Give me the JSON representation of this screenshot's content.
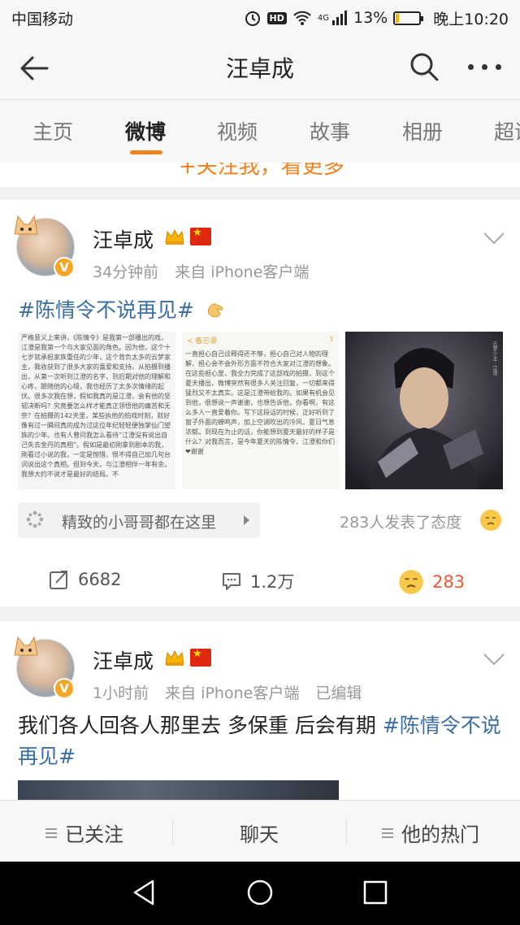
{
  "status_bar": {
    "carrier": "中国移动",
    "hd": "HD",
    "network": "4G",
    "battery": "13%",
    "battery_level": 0.13,
    "time": "晚上10:20"
  },
  "nav": {
    "title": "汪卓成"
  },
  "tabs": [
    {
      "label": "主页",
      "active": false
    },
    {
      "label": "微博",
      "active": true
    },
    {
      "label": "视频",
      "active": false
    },
    {
      "label": "故事",
      "active": false
    },
    {
      "label": "相册",
      "active": false
    },
    {
      "label": "超话",
      "active": false
    }
  ],
  "partial_banner": "+关注我，看更多",
  "posts": [
    {
      "username": "汪卓成",
      "time": "34分钟前",
      "source": "来自 iPhone客户端",
      "text": "#陈情令不说再见#",
      "images": [
        {
          "text": "严格意义上来讲，《陈情令》是我第一部播出的戏，江澄是我第一个与大家见面的角色。因为他，这个十七岁就承担家族重任的少年，这个背负太多的云梦家主，我收获到了很多大家的喜爱和支持。从拍摄到播出，从第一次听到江澄的名字，到后期对他的理解和心疼，跟随他的心境，我也经历了太多次情绪的起伏。很多次我在想，假如我真的是江澄，会有他的坚韧决断吗？究竟要怎么样才能真正领悟他的痛苦和无奈？在拍摄的142天里，某些执他的拍戏时刻，就好像有过一瞬间真的成为过这位年纪轻轻便独掌仙门望族的少年。也有人曾问我怎么看待“江澄没有说出自己失去金丹的真相”。假如是最初刚拿到剧本的我，刚看过小说的我，一定是惋惜，恨不得自己加几句台词说出这个真相。但到今天，与江澄相伴一年有余，我想大约不说才是最好的结局。不"
        },
        {
          "memo_label": "< 备忘录",
          "text": "一直担心自己诠释得还不够，担心自己对人物的理解，担心会不会外形方面不符合大家对江澄的想象。在这些担心里，我全力完成了这部戏的拍摄，到这个夏天播出，微博突然有很多人关注回复，一切都来得猛烈又不太真实。这是江澄带给我的。如果有机会见到他，很想说一声谢谢，也想告诉他，你看啊，有这么多人一直爱着你。写下这段话的时候，正好听到了窗子外面的蝉鸣声，加上空调吹出的冷风，夏日气息浓郁。到现在为止的话，你能想到夏天最好的样子是什么？对我而言，是今年夏天的陈情令、江澄和你们❤谢谢"
        },
        {
          "caption": "云梦少主 · 江澄"
        }
      ],
      "topic_chip": "精致的小哥哥都在这里",
      "reactions_note": "283人发表了态度",
      "reposts": "6682",
      "comments": "1.2万",
      "likes": "283"
    },
    {
      "username": "汪卓成",
      "time": "1小时前",
      "source": "来自 iPhone客户端",
      "edited": "已编辑",
      "text_plain": "我们各人回各人那里去 多保重 后会有期 ",
      "text_tag": "#陈情令不说再见#"
    }
  ],
  "bottom_bar": {
    "follow": "已关注",
    "chat": "聊天",
    "hot": "他的热门"
  },
  "colors": {
    "accent": "#f08220",
    "link": "#3a6ea5",
    "like": "#e85a35"
  }
}
